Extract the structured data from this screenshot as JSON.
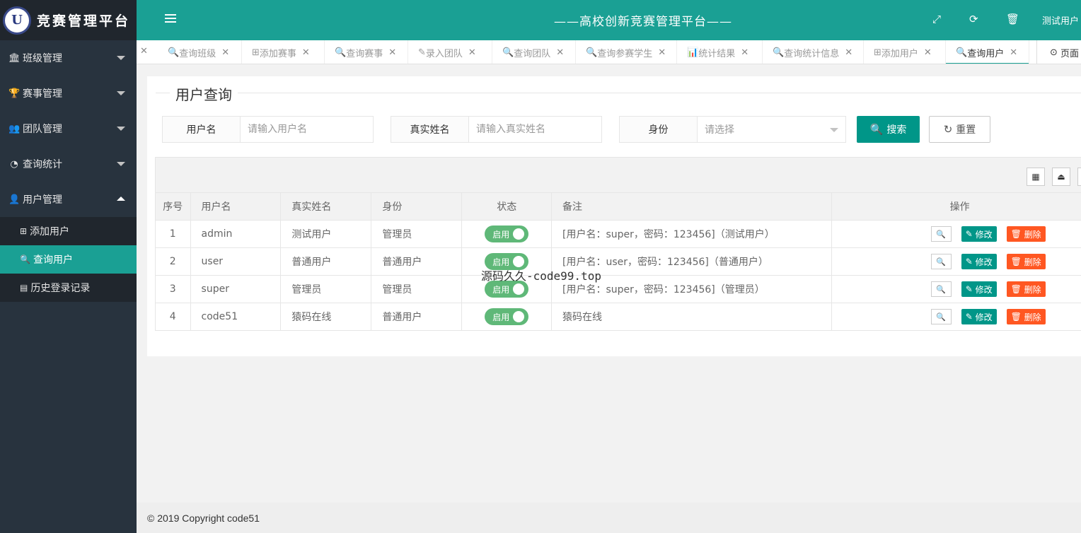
{
  "app": {
    "logo_text": "竞赛管理平台",
    "logo_letter": "U",
    "header_title": "——高校创新竞赛管理平台——",
    "user": "测试用户"
  },
  "sidebar": {
    "menus": [
      {
        "label": "班级管理",
        "icon": "bank-icon",
        "glyph": "🏛"
      },
      {
        "label": "赛事管理",
        "icon": "trophy-icon",
        "glyph": "🏆"
      },
      {
        "label": "团队管理",
        "icon": "users-icon",
        "glyph": "👥"
      },
      {
        "label": "查询统计",
        "icon": "pie-chart-icon",
        "glyph": "◔"
      },
      {
        "label": "用户管理",
        "icon": "user-icon",
        "glyph": "👤"
      }
    ],
    "sub_items": [
      {
        "label": "添加用户",
        "icon": "plus-square-icon",
        "glyph": "⊞"
      },
      {
        "label": "查询用户",
        "icon": "search-icon",
        "glyph": "🔍"
      },
      {
        "label": "历史登录记录",
        "icon": "list-icon",
        "glyph": "▤"
      }
    ]
  },
  "tabs": [
    {
      "label": "查询班级",
      "glyph": "🔍"
    },
    {
      "label": "添加赛事",
      "glyph": "⊞"
    },
    {
      "label": "查询赛事",
      "glyph": "🔍"
    },
    {
      "label": "录入团队",
      "glyph": "✎"
    },
    {
      "label": "查询团队",
      "glyph": "🔍"
    },
    {
      "label": "查询参赛学生",
      "glyph": "🔍"
    },
    {
      "label": "统计结果",
      "glyph": "📊"
    },
    {
      "label": "查询统计信息",
      "glyph": "🔍"
    },
    {
      "label": "添加用户",
      "glyph": "⊞"
    },
    {
      "label": "查询用户",
      "glyph": "🔍"
    }
  ],
  "tab_page_label": "页面",
  "form": {
    "title": "用户查询",
    "username_label": "用户名",
    "username_placeholder": "请输入用户名",
    "realname_label": "真实姓名",
    "realname_placeholder": "请输入真实姓名",
    "role_label": "身份",
    "role_selected": "请选择",
    "search_btn": "搜索",
    "reset_btn": "重置"
  },
  "table": {
    "headers": [
      "序号",
      "用户名",
      "真实姓名",
      "身份",
      "状态",
      "备注",
      "操作"
    ],
    "rows": [
      {
        "no": "1",
        "username": "admin",
        "realname": "测试用户",
        "role": "管理员",
        "status": "启用",
        "remark": "[用户名：super，密码：123456]（测试用户）"
      },
      {
        "no": "2",
        "username": "user",
        "realname": "普通用户",
        "role": "普通用户",
        "status": "启用",
        "remark": "[用户名：user，密码：123456]（普通用户）"
      },
      {
        "no": "3",
        "username": "super",
        "realname": "管理员",
        "role": "管理员",
        "status": "启用",
        "remark": "[用户名：super，密码：123456]（管理员）"
      },
      {
        "no": "4",
        "username": "code51",
        "realname": "猿码在线",
        "role": "普通用户",
        "status": "启用",
        "remark": "猿码在线"
      }
    ],
    "edit_label": "修改",
    "delete_label": "删除"
  },
  "watermark": "源码久久-code99.top",
  "footer": "© 2019 Copyright code51",
  "colors": {
    "primary": "#009688",
    "header": "#1aa094",
    "sidebar": "#28333e",
    "danger": "#ff5722",
    "switch_on": "#5fb878"
  }
}
